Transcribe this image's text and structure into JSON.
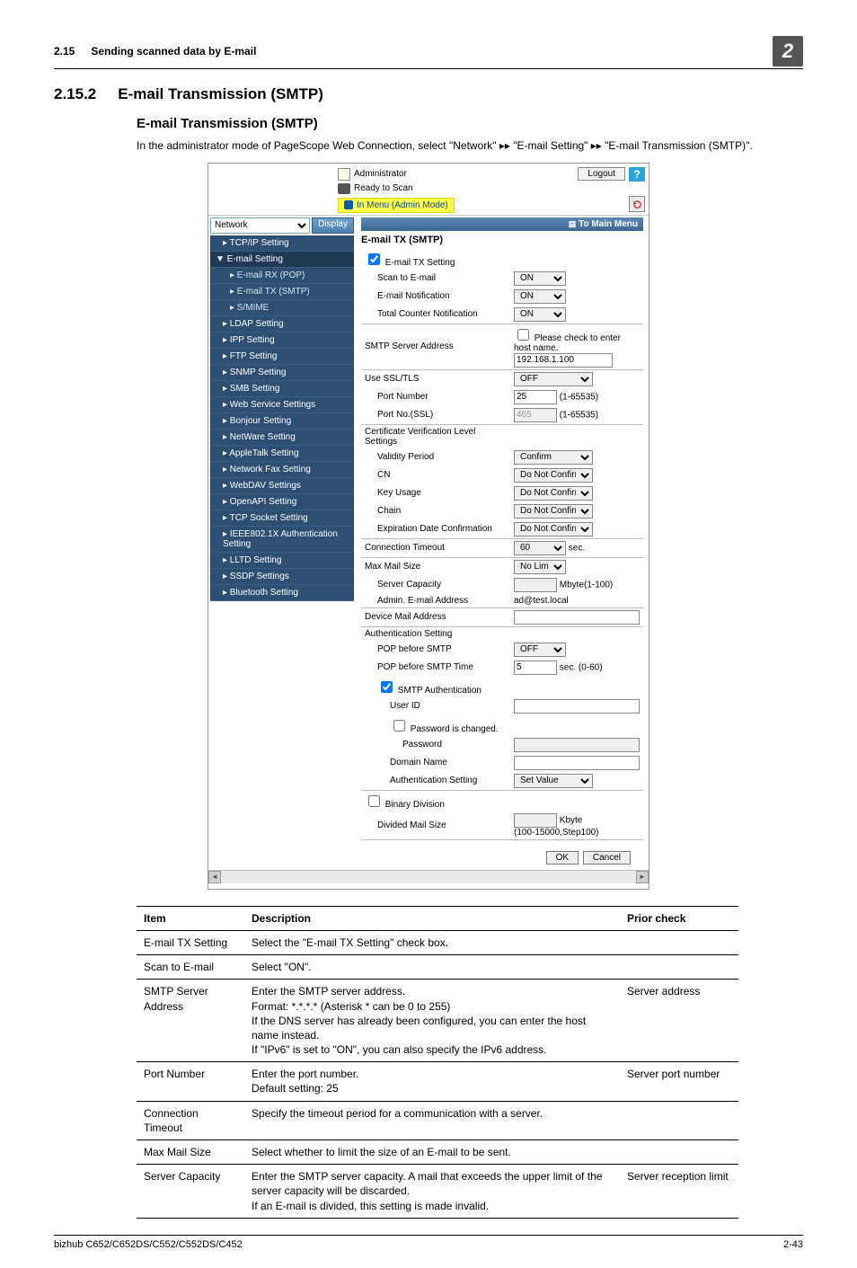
{
  "header": {
    "section_number": "2.15",
    "section_title": "Sending scanned data by E-mail",
    "chapter": "2"
  },
  "section2": {
    "num": "2.15.2",
    "title": "E-mail Transmission (SMTP)"
  },
  "section3": "E-mail Transmission (SMTP)",
  "intro": "In the administrator mode of PageScope Web Connection, select \"Network\" ▸▸ \"E-mail Setting\" ▸▸ \"E-mail Transmission (SMTP)\".",
  "footer": {
    "model": "bizhub C652/C652DS/C552/C552DS/C452",
    "page": "2-43"
  },
  "web": {
    "admin_label": "Administrator",
    "logout": "Logout",
    "ready": "Ready to Scan",
    "admin_mode": "In Menu (Admin Mode)",
    "category": "Network",
    "display": "Display",
    "tomain": "To Main Menu",
    "nav": [
      "TCP/IP Setting",
      "E-mail Setting",
      "E-mail RX (POP)",
      "E-mail TX (SMTP)",
      "S/MIME",
      "LDAP Setting",
      "IPP Setting",
      "FTP Setting",
      "SNMP Setting",
      "SMB Setting",
      "Web Service Settings",
      "Bonjour Setting",
      "NetWare Setting",
      "AppleTalk Setting",
      "Network Fax Setting",
      "WebDAV Settings",
      "OpenAPI Setting",
      "TCP Socket Setting",
      "IEEE802.1X Authentication Setting",
      "LLTD Setting",
      "SSDP Settings",
      "Bluetooth Setting"
    ],
    "panel_title": "E-mail TX (SMTP)",
    "rows": {
      "tx_setting": "E-mail TX Setting",
      "scan_to": "Scan to E-mail",
      "notif": "E-mail Notification",
      "total": "Total Counter Notification",
      "smtp_addr": "SMTP Server Address",
      "hostcheck": "Please check to enter host name.",
      "smtp_addr_val": "192.168.1.100",
      "ssl": "Use SSL/TLS",
      "portnum": "Port Number",
      "portnum_val": "25",
      "portnum_range": "(1-65535)",
      "portssl": "Port No.(SSL)",
      "portssl_val": "465",
      "portssl_range": "(1-65535)",
      "cert": "Certificate Verification Level Settings",
      "validity": "Validity Period",
      "cn": "CN",
      "keyusage": "Key Usage",
      "chain": "Chain",
      "expdate": "Expiration Date Confirmation",
      "conntimeout": "Connection Timeout",
      "conntimeout_val": "60",
      "sec": "sec.",
      "maxmail": "Max Mail Size",
      "servercap": "Server Capacity",
      "servercap_unit": "Mbyte(1-100)",
      "adminemail": "Admin. E-mail Address",
      "adminemail_val": "ad@test.local",
      "devmail": "Device Mail Address",
      "authsetting": "Authentication Setting",
      "popbefore": "POP before SMTP",
      "poptime": "POP before SMTP Time",
      "poptime_val": "5",
      "poptime_unit": "sec. (0-60)",
      "smtp_auth": "SMTP Authentication",
      "userid": "User ID",
      "pwchanged": "Password is changed.",
      "password": "Password",
      "domain": "Domain Name",
      "authset2": "Authentication Setting",
      "binary": "Binary Division",
      "divided": "Divided Mail Size",
      "divided_unit": "Kbyte",
      "divided_range": "(100-15000,Step100)",
      "on": "ON",
      "off": "OFF",
      "confirm": "Confirm",
      "donot": "Do Not Confirm",
      "nolimit": "No Limit",
      "setvalue": "Set Value"
    },
    "ok": "OK",
    "cancel": "Cancel"
  },
  "doc_table": {
    "headers": [
      "Item",
      "Description",
      "Prior check"
    ],
    "rows": [
      [
        "E-mail TX Setting",
        "Select the \"E-mail TX Setting\" check box.",
        ""
      ],
      [
        "Scan to E-mail",
        "Select \"ON\".",
        ""
      ],
      [
        "SMTP Server Address",
        "Enter the SMTP server address.\nFormat: *.*.*.* (Asterisk * can be 0 to 255)\nIf the DNS server has already been configured, you can enter the host name instead.\nIf \"IPv6\" is set to \"ON\", you can also specify the IPv6 address.",
        "Server address"
      ],
      [
        "Port Number",
        "Enter the port number.\nDefault setting: 25",
        "Server port number"
      ],
      [
        "Connection Timeout",
        "Specify the timeout period for a communication with a server.",
        ""
      ],
      [
        "Max Mail Size",
        "Select whether to limit the size of an E-mail to be sent.",
        ""
      ],
      [
        "Server Capacity",
        "Enter the SMTP server capacity. A mail that exceeds the upper limit of the server capacity will be discarded.\nIf an E-mail is divided, this setting is made invalid.",
        "Server reception limit"
      ]
    ]
  }
}
